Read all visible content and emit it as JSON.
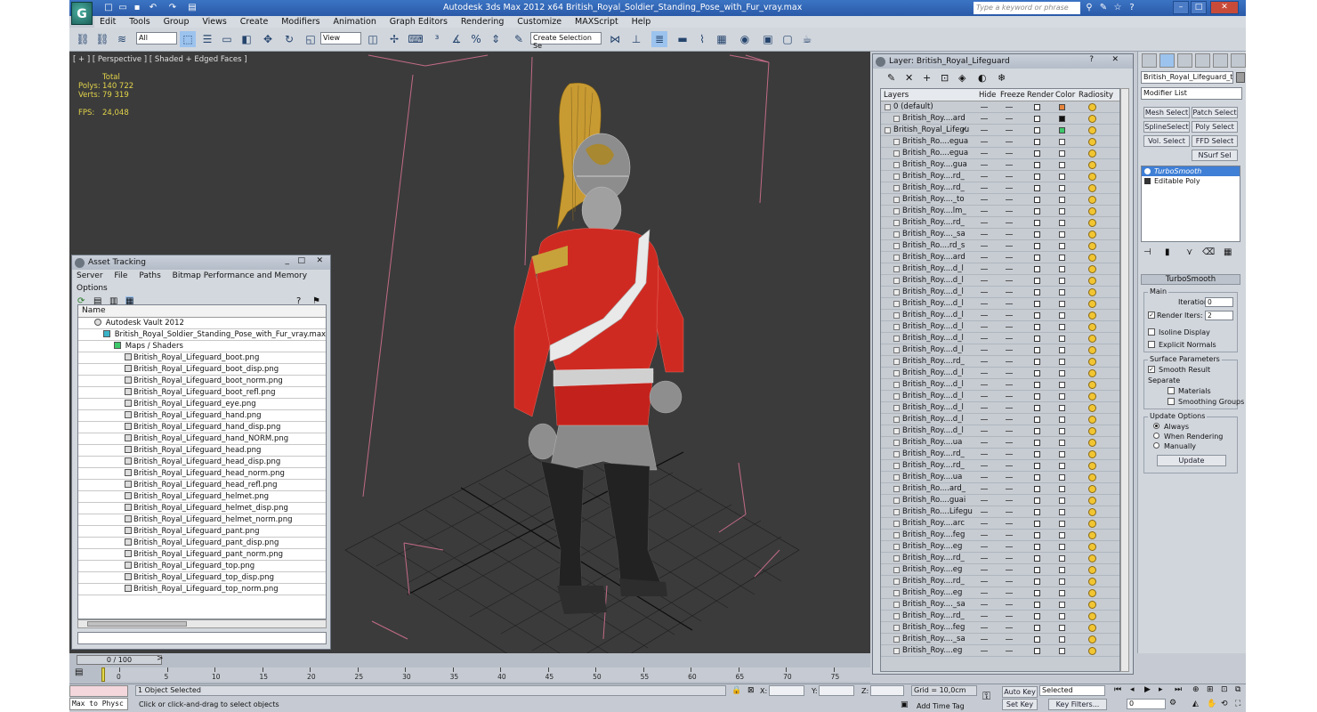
{
  "app": {
    "title": "Autodesk 3ds Max  2012 x64      British_Royal_Soldier_Standing_Pose_with_Fur_vray.max",
    "search_placeholder": "Type a keyword or phrase",
    "logo_letter": "G"
  },
  "menu": [
    "Edit",
    "Tools",
    "Group",
    "Views",
    "Create",
    "Modifiers",
    "Animation",
    "Graph Editors",
    "Rendering",
    "Customize",
    "MAXScript",
    "Help"
  ],
  "toolbar": {
    "filter_select": "All",
    "refcoord_select": "View",
    "named_selection": "Create Selection Se"
  },
  "viewport": {
    "label": "[ + ] [ Perspective ] [ Shaded + Edged Faces ]",
    "stats": {
      "total_label": "Total",
      "polys_label": "Polys:",
      "polys_value": "140 722",
      "verts_label": "Verts:",
      "verts_value": "79 319",
      "fps_label": "FPS:",
      "fps_value": "24,048"
    }
  },
  "asset_tracking": {
    "title": "Asset Tracking",
    "menu": [
      "Server",
      "File",
      "Paths",
      "Bitmap Performance and Memory",
      "Options"
    ],
    "column_name": "Name",
    "vault": "Autodesk Vault 2012",
    "max_file": "British_Royal_Soldier_Standing_Pose_with_Fur_vray.max",
    "maps_folder": "Maps / Shaders",
    "files": [
      "British_Royal_Lifeguard_boot.png",
      "British_Royal_Lifeguard_boot_disp.png",
      "British_Royal_Lifeguard_boot_norm.png",
      "British_Royal_Lifeguard_boot_refl.png",
      "British_Royal_Lifeguard_eye.png",
      "British_Royal_Lifeguard_hand.png",
      "British_Royal_Lifeguard_hand_disp.png",
      "British_Royal_Lifeguard_hand_NORM.png",
      "British_Royal_Lifeguard_head.png",
      "British_Royal_Lifeguard_head_disp.png",
      "British_Royal_Lifeguard_head_norm.png",
      "British_Royal_Lifeguard_head_refl.png",
      "British_Royal_Lifeguard_helmet.png",
      "British_Royal_Lifeguard_helmet_disp.png",
      "British_Royal_Lifeguard_helmet_norm.png",
      "British_Royal_Lifeguard_pant.png",
      "British_Royal_Lifeguard_pant_disp.png",
      "British_Royal_Lifeguard_pant_norm.png",
      "British_Royal_Lifeguard_top.png",
      "British_Royal_Lifeguard_top_disp.png",
      "British_Royal_Lifeguard_top_norm.png"
    ]
  },
  "layer_panel": {
    "title": "Layer: British_Royal_Lifeguard",
    "columns": {
      "layers": "Layers",
      "hide": "Hide",
      "freeze": "Freeze",
      "render": "Render",
      "color": "Color",
      "radiosity": "Radiosity"
    },
    "rows": [
      {
        "name": "0 (default)",
        "level": 0,
        "color": "#e8843c"
      },
      {
        "name": "British_Roy....ard",
        "level": 1,
        "color": "#111111"
      },
      {
        "name": "British_Royal_Lifegu",
        "level": 0,
        "color": "#3cc86a",
        "check": true
      },
      {
        "name": "British_Ro....egua",
        "level": 1
      },
      {
        "name": "British_Ro....egua",
        "level": 1
      },
      {
        "name": "British_Roy....gua",
        "level": 1
      },
      {
        "name": "British_Roy....rd_",
        "level": 1
      },
      {
        "name": "British_Roy....rd_",
        "level": 1
      },
      {
        "name": "British_Roy...._to",
        "level": 1
      },
      {
        "name": "British_Roy....lm_",
        "level": 1
      },
      {
        "name": "British_Roy....rd_",
        "level": 1
      },
      {
        "name": "British_Roy...._sa",
        "level": 1
      },
      {
        "name": "British_Ro....rd_s",
        "level": 1
      },
      {
        "name": "British_Roy....ard",
        "level": 1
      },
      {
        "name": "British_Roy....d_l",
        "level": 1
      },
      {
        "name": "British_Roy....d_l",
        "level": 1
      },
      {
        "name": "British_Roy....d_l",
        "level": 1
      },
      {
        "name": "British_Roy....d_l",
        "level": 1
      },
      {
        "name": "British_Roy....d_l",
        "level": 1
      },
      {
        "name": "British_Roy....d_l",
        "level": 1
      },
      {
        "name": "British_Roy....d_l",
        "level": 1
      },
      {
        "name": "British_Roy....d_l",
        "level": 1
      },
      {
        "name": "British_Roy....rd_",
        "level": 1
      },
      {
        "name": "British_Roy....d_l",
        "level": 1
      },
      {
        "name": "British_Roy....d_l",
        "level": 1
      },
      {
        "name": "British_Roy....d_l",
        "level": 1
      },
      {
        "name": "British_Roy....d_l",
        "level": 1
      },
      {
        "name": "British_Roy....d_l",
        "level": 1
      },
      {
        "name": "British_Roy....d_l",
        "level": 1
      },
      {
        "name": "British_Roy....ua",
        "level": 1
      },
      {
        "name": "British_Roy....rd_",
        "level": 1
      },
      {
        "name": "British_Roy....rd_",
        "level": 1
      },
      {
        "name": "British_Roy....ua",
        "level": 1
      },
      {
        "name": "British_Ro....ard_",
        "level": 1
      },
      {
        "name": "British_Ro....guai",
        "level": 1
      },
      {
        "name": "British_Ro....Lifegu",
        "level": 1
      },
      {
        "name": "British_Roy....arc",
        "level": 1
      },
      {
        "name": "British_Roy....feg",
        "level": 1
      },
      {
        "name": "British_Roy....eg",
        "level": 1
      },
      {
        "name": "British_Roy....rd_",
        "level": 1
      },
      {
        "name": "British_Roy....eg",
        "level": 1
      },
      {
        "name": "British_Roy....rd_",
        "level": 1
      },
      {
        "name": "British_Roy....eg",
        "level": 1
      },
      {
        "name": "British_Roy...._sa",
        "level": 1
      },
      {
        "name": "British_Roy....rd_",
        "level": 1
      },
      {
        "name": "British_Roy....feg",
        "level": 1
      },
      {
        "name": "British_Roy...._sa",
        "level": 1
      },
      {
        "name": "British_Roy....eg",
        "level": 1
      }
    ]
  },
  "command_panel": {
    "object_name": "British_Royal_Lifeguard_top_",
    "modifier_list": "Modifier List",
    "buttons": [
      "Mesh Select",
      "Patch Select",
      "SplineSelect",
      "Poly Select",
      "Vol. Select",
      "FFD Select",
      "NSurf Sel"
    ],
    "stack": [
      "TurboSmooth",
      "Editable Poly"
    ],
    "rollout_title": "TurboSmooth",
    "main_label": "Main",
    "iterations_label": "Iterations:",
    "iterations_value": "0",
    "render_iters_label": "Render Iters:",
    "render_iters_value": "2",
    "isoline_label": "Isoline Display",
    "explicit_normals_label": "Explicit Normals",
    "surface_params_label": "Surface Parameters",
    "smooth_result_label": "Smooth Result",
    "separate_label": "Separate",
    "materials_label": "Materials",
    "smoothing_groups_label": "Smoothing Groups",
    "update_options_label": "Update Options",
    "always_label": "Always",
    "when_rendering_label": "When Rendering",
    "manually_label": "Manually",
    "update_button": "Update"
  },
  "timeline": {
    "slider_label": "0 / 100",
    "ticks": [
      "0",
      "5",
      "10",
      "15",
      "20",
      "25",
      "30",
      "35",
      "40",
      "45",
      "50",
      "55",
      "60",
      "65",
      "70",
      "75",
      "80"
    ]
  },
  "status": {
    "script_listener": "Max to Physc",
    "selection_info": "1 Object Selected",
    "prompt": "Click or click-and-drag to select objects",
    "x_label": "X:",
    "y_label": "Y:",
    "z_label": "Z:",
    "grid": "Grid = 10,0cm",
    "add_time_tag": "Add Time Tag",
    "auto_key": "Auto Key",
    "set_key": "Set Key",
    "selected_select": "Selected",
    "key_filters": "Key Filters...",
    "frame_value": "0"
  }
}
